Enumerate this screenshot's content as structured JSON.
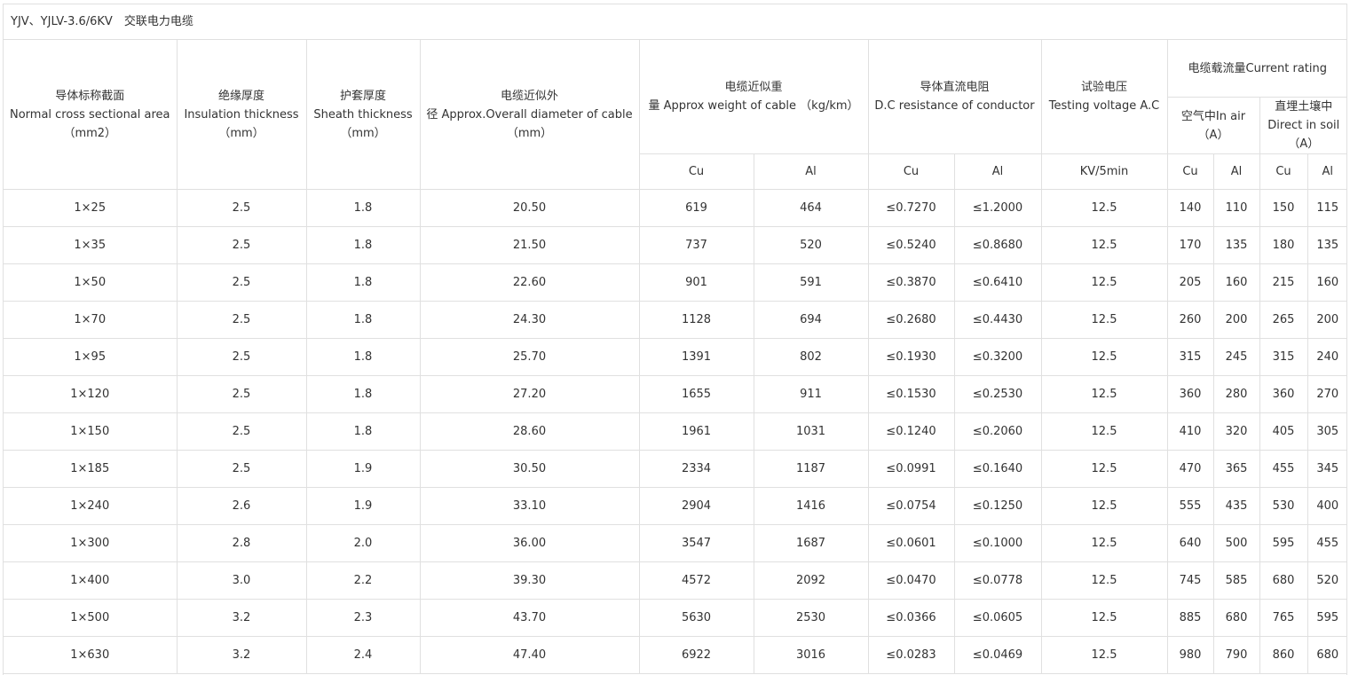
{
  "caption": "YJV、YJLV-3.6/6KV　交联电力电缆",
  "headers": {
    "area": [
      "导体标称截面",
      "Normal cross sectional area",
      "（mm2）"
    ],
    "insulation": [
      "绝缘厚度",
      "Insulation thickness",
      "（mm）"
    ],
    "sheath": [
      "护套厚度",
      "Sheath thickness",
      "（mm）"
    ],
    "diameter": [
      "电缆近似外",
      "径 Approx.Overall diameter of cable",
      "（mm）"
    ],
    "weight": [
      "电缆近似重",
      "量 Approx weight of cable （kg/km）"
    ],
    "resistance": [
      "导体直流电阻",
      "D.C resistance of conductor"
    ],
    "voltage": [
      "试验电压",
      "Testing voltage A.C"
    ],
    "current": "电缆载流量Current rating",
    "air": [
      "空气中In air",
      "（A）"
    ],
    "soil": [
      "直埋土壤中",
      "Direct in soil",
      "（A）"
    ],
    "cu": "Cu",
    "al": "Al",
    "kv": "KV/5min"
  },
  "rows": [
    [
      "1×25",
      "2.5",
      "1.8",
      "20.50",
      "619",
      "464",
      "≤0.7270",
      "≤1.2000",
      "12.5",
      "140",
      "110",
      "150",
      "115"
    ],
    [
      "1×35",
      "2.5",
      "1.8",
      "21.50",
      "737",
      "520",
      "≤0.5240",
      "≤0.8680",
      "12.5",
      "170",
      "135",
      "180",
      "135"
    ],
    [
      "1×50",
      "2.5",
      "1.8",
      "22.60",
      "901",
      "591",
      "≤0.3870",
      "≤0.6410",
      "12.5",
      "205",
      "160",
      "215",
      "160"
    ],
    [
      "1×70",
      "2.5",
      "1.8",
      "24.30",
      "1128",
      "694",
      "≤0.2680",
      "≤0.4430",
      "12.5",
      "260",
      "200",
      "265",
      "200"
    ],
    [
      "1×95",
      "2.5",
      "1.8",
      "25.70",
      "1391",
      "802",
      "≤0.1930",
      "≤0.3200",
      "12.5",
      "315",
      "245",
      "315",
      "240"
    ],
    [
      "1×120",
      "2.5",
      "1.8",
      "27.20",
      "1655",
      "911",
      "≤0.1530",
      "≤0.2530",
      "12.5",
      "360",
      "280",
      "360",
      "270"
    ],
    [
      "1×150",
      "2.5",
      "1.8",
      "28.60",
      "1961",
      "1031",
      "≤0.1240",
      "≤0.2060",
      "12.5",
      "410",
      "320",
      "405",
      "305"
    ],
    [
      "1×185",
      "2.5",
      "1.9",
      "30.50",
      "2334",
      "1187",
      "≤0.0991",
      "≤0.1640",
      "12.5",
      "470",
      "365",
      "455",
      "345"
    ],
    [
      "1×240",
      "2.6",
      "1.9",
      "33.10",
      "2904",
      "1416",
      "≤0.0754",
      "≤0.1250",
      "12.5",
      "555",
      "435",
      "530",
      "400"
    ],
    [
      "1×300",
      "2.8",
      "2.0",
      "36.00",
      "3547",
      "1687",
      "≤0.0601",
      "≤0.1000",
      "12.5",
      "640",
      "500",
      "595",
      "455"
    ],
    [
      "1×400",
      "3.0",
      "2.2",
      "39.30",
      "4572",
      "2092",
      "≤0.0470",
      "≤0.0778",
      "12.5",
      "745",
      "585",
      "680",
      "520"
    ],
    [
      "1×500",
      "3.2",
      "2.3",
      "43.70",
      "5630",
      "2530",
      "≤0.0366",
      "≤0.0605",
      "12.5",
      "885",
      "680",
      "765",
      "595"
    ],
    [
      "1×630",
      "3.2",
      "2.4",
      "47.40",
      "6922",
      "3016",
      "≤0.0283",
      "≤0.0469",
      "12.5",
      "980",
      "790",
      "860",
      "680"
    ]
  ]
}
